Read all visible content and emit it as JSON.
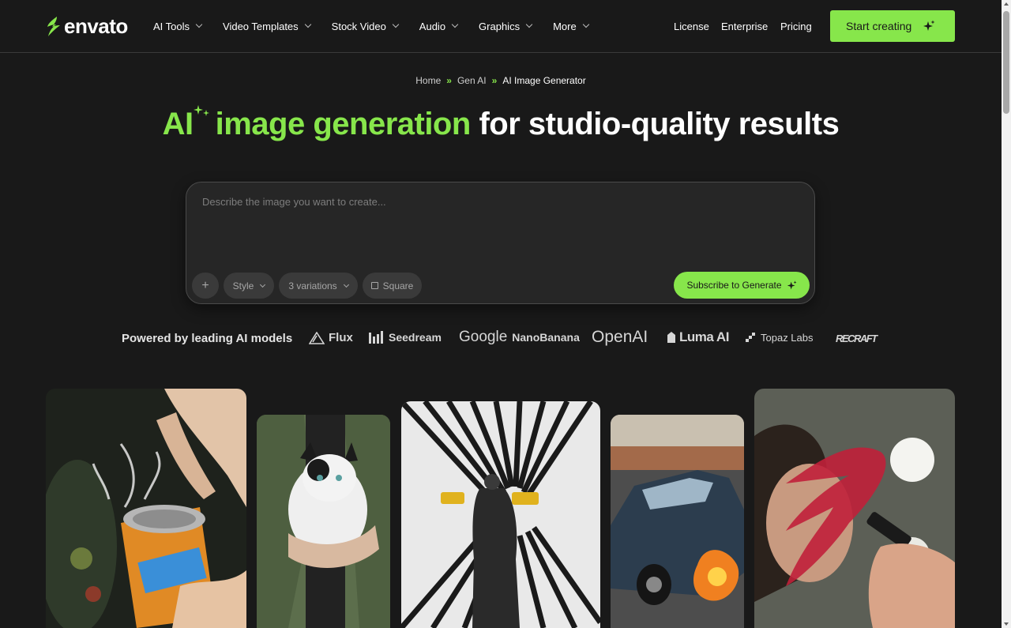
{
  "header": {
    "logo_text": "envato",
    "nav": [
      "AI Tools",
      "Video Templates",
      "Stock Video",
      "Audio",
      "Graphics",
      "More"
    ],
    "links": [
      "License",
      "Enterprise",
      "Pricing"
    ],
    "cta_label": "Start creating"
  },
  "breadcrumb": {
    "items": [
      "Home",
      "Gen AI",
      "AI Image Generator"
    ],
    "separator": "»"
  },
  "hero": {
    "title_part1": "AI",
    "title_part2": "image generation",
    "title_part3": "for studio-quality results"
  },
  "prompt": {
    "placeholder": "Describe the image you want to create...",
    "add_symbol": "+",
    "style_label": "Style",
    "variations_label": "3 variations",
    "aspect_label": "Square",
    "generate_label": "Subscribe to Generate"
  },
  "powered_by": {
    "label": "Powered by leading AI models",
    "brands": {
      "flux": "Flux",
      "seedream": "Seedream",
      "google": "Google",
      "nanobanana": "NanoBanana",
      "openai": "OpenAI",
      "luma": "Luma AI",
      "topaz": "Topaz Labs",
      "recraft": "RECRAFT"
    }
  },
  "colors": {
    "accent": "#87e64b",
    "background": "#191919",
    "panel": "#262626"
  }
}
